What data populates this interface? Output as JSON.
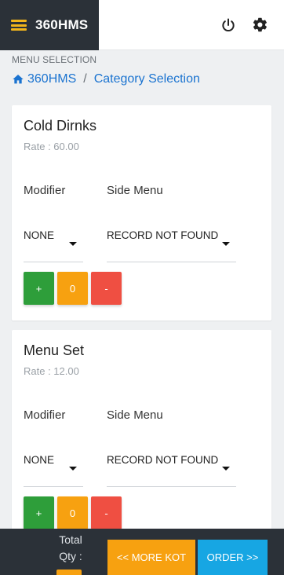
{
  "header": {
    "brand": "360HMS",
    "icons": [
      "menu-icon",
      "power-icon",
      "gear-icon"
    ],
    "brand_color": "#2b3138",
    "accent": "#f2b51b"
  },
  "page": {
    "section_title": "MENU SELECTION",
    "breadcrumb": {
      "home": "360HMS",
      "separator": "/",
      "current": "Category Selection"
    }
  },
  "items": [
    {
      "name": "Cold Dirnks",
      "rate": "Rate : 60.00",
      "modifier_label": "Modifier",
      "side_menu_label": "Side Menu",
      "modifier_value": "NONE",
      "side_menu_value": "RECORD NOT FOUND",
      "plus": "+",
      "qty": "0",
      "minus": "-"
    },
    {
      "name": "Menu Set",
      "rate": "Rate : 12.00",
      "modifier_label": "Modifier",
      "side_menu_label": "Side Menu",
      "modifier_value": "NONE",
      "side_menu_value": "RECORD NOT FOUND",
      "plus": "+",
      "qty": "0",
      "minus": "-"
    }
  ],
  "footer": {
    "total_label": "Total Qty :",
    "more_kot": "<< MORE KOT",
    "order": "ORDER >>"
  },
  "colors": {
    "plus": "#2e9e3a",
    "qty": "#f7a110",
    "minus": "#ef4f42",
    "order": "#17a6e3",
    "link": "#1a73d0"
  }
}
